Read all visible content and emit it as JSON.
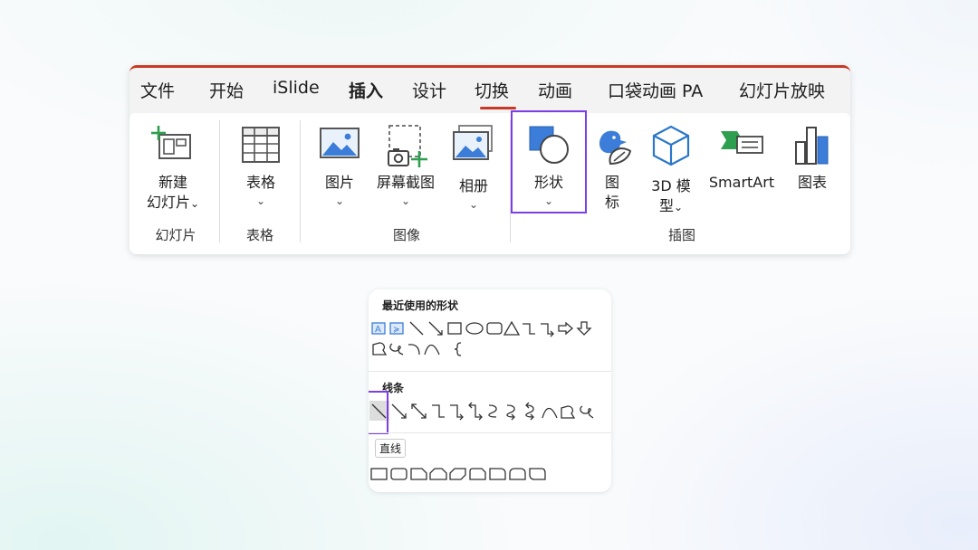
{
  "ribbon": {
    "accent_color": "#c93a26",
    "highlight_color": "#7b3fe4",
    "tabs": [
      {
        "label": "文件"
      },
      {
        "label": "开始"
      },
      {
        "label": "iSlide"
      },
      {
        "label": "插入",
        "active": true
      },
      {
        "label": "设计"
      },
      {
        "label": "切换"
      },
      {
        "label": "动画"
      },
      {
        "label": "口袋动画 PA"
      },
      {
        "label": "幻灯片放映"
      }
    ],
    "buttons": {
      "new_slide": {
        "line1": "新建",
        "line2": "幻灯片",
        "chevron": "⌄",
        "icon": "new-slide-icon"
      },
      "table": {
        "label": "表格",
        "chevron": "⌄",
        "icon": "table-icon"
      },
      "picture": {
        "label": "图片",
        "chevron": "⌄",
        "icon": "picture-icon"
      },
      "screenshot": {
        "label": "屏幕截图",
        "chevron": "⌄",
        "icon": "screenshot-icon"
      },
      "album": {
        "label": "相册",
        "chevron": "⌄",
        "icon": "photo-album-icon"
      },
      "shapes": {
        "label": "形状",
        "chevron": "⌄",
        "icon": "shapes-icon"
      },
      "icons": {
        "line1": "图",
        "line2": "标",
        "icon": "icons-icon"
      },
      "model3d": {
        "line1": "3D 模",
        "line2": "型",
        "chevron": "⌄",
        "icon": "3d-model-icon"
      },
      "smartart": {
        "label": "SmartArt",
        "icon": "smartart-icon"
      },
      "chart": {
        "label": "图表",
        "icon": "chart-icon"
      }
    },
    "groups": {
      "slides": "幻灯片",
      "tables": "表格",
      "images": "图像",
      "illustrations": "插图"
    }
  },
  "shapes_menu": {
    "recent_title": "最近使用的形状",
    "lines_title": "线条",
    "tooltip": "直线",
    "recent_row1": [
      "text-box-icon",
      "vertical-text-box-icon",
      "line-icon",
      "arrow-line-icon",
      "rectangle-icon",
      "oval-icon",
      "rounded-rectangle-icon",
      "triangle-icon",
      "elbow-connector-icon",
      "elbow-arrow-connector-icon",
      "right-arrow-icon",
      "down-arrow-icon"
    ],
    "recent_row2": [
      "freeform-shape-icon",
      "scribble-icon",
      "arc-icon",
      "curve-icon",
      "brace-icon"
    ],
    "lines_row": [
      "line-icon",
      "arrow-line-icon",
      "double-arrow-line-icon",
      "elbow-connector-icon",
      "elbow-arrow-connector-icon",
      "elbow-double-arrow-connector-icon",
      "curved-connector-icon",
      "curved-arrow-connector-icon",
      "curved-double-arrow-connector-icon",
      "curve-icon",
      "freeform-shape-icon",
      "scribble-icon"
    ],
    "rect_row": [
      "rectangle-icon",
      "rounded-rectangle-icon",
      "snip-corner-rectangle-icon",
      "snip-same-side-rectangle-icon",
      "snip-diagonal-rectangle-icon",
      "snip-round-rectangle-icon",
      "round-corner-rectangle-icon",
      "round-same-side-rectangle-icon",
      "round-diagonal-rectangle-icon"
    ]
  }
}
